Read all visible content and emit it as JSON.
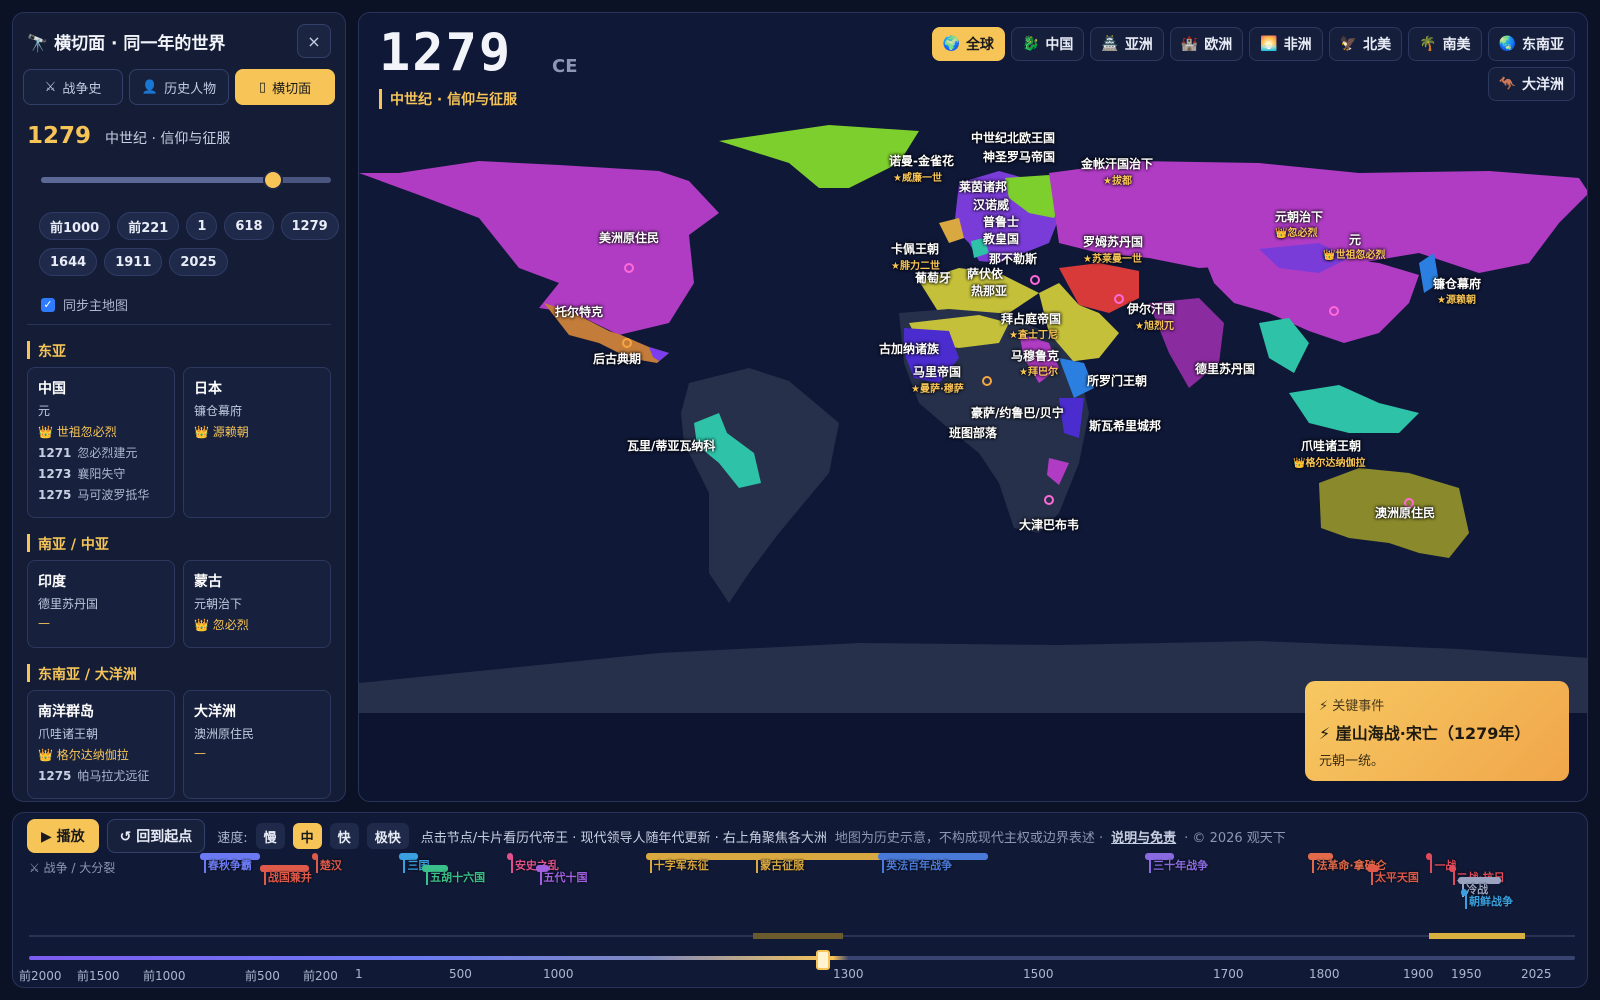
{
  "sidebar": {
    "title": "🔭 横切面 · 同一年的世界",
    "close": "×",
    "tabs": [
      {
        "icon": "⚔",
        "label": "战争史"
      },
      {
        "icon": "👤",
        "label": "历史人物"
      },
      {
        "icon": "▯",
        "label": "横切面"
      }
    ],
    "year": "1279",
    "era": "中世纪 · 信仰与征服",
    "slider_fraction": 0.8,
    "chips": [
      "前1000",
      "前221",
      "1",
      "618",
      "1279",
      "1644",
      "1911",
      "2025"
    ],
    "sync_label": "同步主地图",
    "sync_check": "✓",
    "regions": [
      {
        "name": "东亚",
        "cards": [
          {
            "title": "中国",
            "line": "元",
            "ruler": "👑 世祖忽必烈",
            "events": [
              [
                "1271",
                "忽必烈建元"
              ],
              [
                "1273",
                "襄阳失守"
              ],
              [
                "1275",
                "马可波罗抵华"
              ]
            ]
          },
          {
            "title": "日本",
            "line": "镰仓幕府",
            "ruler": "👑 源赖朝",
            "events": []
          }
        ]
      },
      {
        "name": "南亚 / 中亚",
        "cards": [
          {
            "title": "印度",
            "line": "德里苏丹国",
            "ruler": "—",
            "events": []
          },
          {
            "title": "蒙古",
            "line": "元朝治下",
            "ruler": "👑 忽必烈",
            "events": []
          }
        ]
      },
      {
        "name": "东南亚 / 大洋洲",
        "cards": [
          {
            "title": "南洋群岛",
            "line": "爪哇诸王朝",
            "ruler": "👑 格尔达纳伽拉",
            "events": [
              [
                "1275",
                "帕马拉尤远征"
              ]
            ]
          },
          {
            "title": "大洋洲",
            "line": "澳洲原住民",
            "ruler": "—",
            "events": []
          }
        ]
      }
    ]
  },
  "map": {
    "year": "1279",
    "ce": "CE",
    "era": "中世纪 · 信仰与征服",
    "region_buttons": [
      {
        "icon": "🌍",
        "label": "全球"
      },
      {
        "icon": "🐉",
        "label": "中国"
      },
      {
        "icon": "🏯",
        "label": "亚洲"
      },
      {
        "icon": "🏰",
        "label": "欧洲"
      },
      {
        "icon": "🌅",
        "label": "非洲"
      },
      {
        "icon": "🦅",
        "label": "北美"
      },
      {
        "icon": "🌴",
        "label": "南美"
      },
      {
        "icon": "🌏",
        "label": "东南亚"
      },
      {
        "icon": "🦘",
        "label": "大洋洲"
      }
    ],
    "labels": [
      {
        "t": "中世纪北欧王国",
        "k": "l"
      },
      {
        "t": "神圣罗马帝国",
        "k": "l"
      },
      {
        "t": "诺曼-金雀花",
        "k": "l"
      },
      {
        "t": "★威廉一世",
        "k": "r"
      },
      {
        "t": "金帐汗国治下",
        "k": "l"
      },
      {
        "t": "★拔都",
        "k": "r"
      },
      {
        "t": "莱茵诸邦",
        "k": "l"
      },
      {
        "t": "汉诺威",
        "k": "l"
      },
      {
        "t": "普鲁士",
        "k": "l"
      },
      {
        "t": "教皇国",
        "k": "l"
      },
      {
        "t": "那不勒斯",
        "k": "l"
      },
      {
        "t": "萨伏依",
        "k": "l"
      },
      {
        "t": "热那亚",
        "k": "l"
      },
      {
        "t": "葡萄牙",
        "k": "l"
      },
      {
        "t": "卡佩王朝",
        "k": "l"
      },
      {
        "t": "★腓力二世",
        "k": "r"
      },
      {
        "t": "美洲原住民",
        "k": "l"
      },
      {
        "t": "罗姆苏丹国",
        "k": "l"
      },
      {
        "t": "★苏莱曼一世",
        "k": "r"
      },
      {
        "t": "元朝治下",
        "k": "l"
      },
      {
        "t": "👑忽必烈",
        "k": "r"
      },
      {
        "t": "元",
        "k": "l"
      },
      {
        "t": "👑世祖忽必烈",
        "k": "r"
      },
      {
        "t": "镰仓幕府",
        "k": "l"
      },
      {
        "t": "★源赖朝",
        "k": "r"
      },
      {
        "t": "托尔特克",
        "k": "l"
      },
      {
        "t": "拜占庭帝国",
        "k": "l"
      },
      {
        "t": "★査士丁尼",
        "k": "r"
      },
      {
        "t": "伊尔汗国",
        "k": "l"
      },
      {
        "t": "★旭烈兀",
        "k": "r"
      },
      {
        "t": "古加纳诸族",
        "k": "l"
      },
      {
        "t": "马穆鲁克",
        "k": "l"
      },
      {
        "t": "★拜巴尔",
        "k": "r"
      },
      {
        "t": "后古典期",
        "k": "l"
      },
      {
        "t": "马里帝国",
        "k": "l"
      },
      {
        "t": "★曼萨·穆萨",
        "k": "r"
      },
      {
        "t": "所罗门王朝",
        "k": "l"
      },
      {
        "t": "德里苏丹国",
        "k": "l"
      },
      {
        "t": "豪萨/约鲁巴/贝宁",
        "k": "l"
      },
      {
        "t": "斯瓦希里城邦",
        "k": "l"
      },
      {
        "t": "班图部落",
        "k": "l"
      },
      {
        "t": "瓦里/蒂亚瓦纳科",
        "k": "l"
      },
      {
        "t": "爪哇诸王朝",
        "k": "l"
      },
      {
        "t": "👑格尔达纳伽拉",
        "k": "r"
      },
      {
        "t": "大津巴布韦",
        "k": "l"
      },
      {
        "t": "澳洲原住民",
        "k": "l"
      }
    ],
    "key_event": {
      "heading": "⚡ 关键事件",
      "title": "⚡ 崖山海战·宋亡（1279年）",
      "desc": "元朝一统。"
    }
  },
  "controls": {
    "play": "▶ 播放",
    "reset": "↺ 回到起点",
    "speed_label": "速度:",
    "speeds": [
      "慢",
      "中",
      "快",
      "极快"
    ],
    "hint": "点击节点/卡片看历代帝王 · 现代领导人随年代更新 · 右上角聚焦各大洲",
    "disclaimer": "地图为历史示意，不构成现代主权或边界表述 ·",
    "link": "说明与免责",
    "copyright": "· © 2026 观天下"
  },
  "timeline": {
    "wars_label": "⚔ 战争 / 大分裂",
    "min": -2000,
    "max": 2025,
    "current": 1279,
    "events": [
      {
        "label": "春秋争霸",
        "start": -770,
        "end": -476,
        "row": 0,
        "color": "#6b7af2"
      },
      {
        "label": "战国兼并",
        "start": -475,
        "end": -221,
        "row": 1,
        "color": "#e05a4a"
      },
      {
        "label": "楚汉",
        "start": -206,
        "end": -202,
        "row": 0,
        "color": "#e05a4a"
      },
      {
        "label": "三国",
        "start": 184,
        "end": 280,
        "row": 0,
        "color": "#3aa0e0"
      },
      {
        "label": "五胡十六国",
        "start": 304,
        "end": 439,
        "row": 1,
        "color": "#3ac08a"
      },
      {
        "label": "安史之乱",
        "start": 755,
        "end": 763,
        "row": 0,
        "color": "#e0508a"
      },
      {
        "label": "五代十国",
        "start": 907,
        "end": 979,
        "row": 1,
        "color": "#a060e0"
      },
      {
        "label": "十字军东征",
        "start": 1096,
        "end": 1291,
        "row": 0,
        "color": "#d9a840"
      },
      {
        "label": "蒙古征服",
        "start": 1206,
        "end": 1368,
        "row": 0,
        "color": "#d9a840"
      },
      {
        "label": "英法百年战争",
        "start": 1337,
        "end": 1453,
        "row": 0,
        "color": "#4a7ad8"
      },
      {
        "label": "三十年战争",
        "start": 1618,
        "end": 1648,
        "row": 0,
        "color": "#8a6ae0"
      },
      {
        "label": "法革命·拿破仑",
        "start": 1789,
        "end": 1815,
        "row": 0,
        "color": "#e06a4a"
      },
      {
        "label": "太平天国",
        "start": 1851,
        "end": 1864,
        "row": 1,
        "color": "#e05a4a"
      },
      {
        "label": "一战",
        "start": 1914,
        "end": 1918,
        "row": 0,
        "color": "#e04a5a"
      },
      {
        "label": "二战·抗日",
        "start": 1937,
        "end": 1945,
        "row": 1,
        "color": "#e04a5a"
      },
      {
        "label": "冷战",
        "start": 1947,
        "end": 1991,
        "row": 2,
        "color": "#9aa4c0"
      },
      {
        "label": "朝鲜战争",
        "start": 1950,
        "end": 1953,
        "row": 3,
        "color": "#3aa0e0"
      }
    ],
    "ticks": [
      {
        "label": "前2000",
        "v": -2000
      },
      {
        "label": "前1500",
        "v": -1500
      },
      {
        "label": "前1000",
        "v": -1000
      },
      {
        "label": "前500",
        "v": -500
      },
      {
        "label": "前200",
        "v": -200
      },
      {
        "label": "1",
        "v": 1
      },
      {
        "label": "500",
        "v": 500
      },
      {
        "label": "1000",
        "v": 1000
      },
      {
        "label": "1300",
        "v": 1300
      },
      {
        "label": "1500",
        "v": 1500
      },
      {
        "label": "1700",
        "v": 1700
      },
      {
        "label": "1800",
        "v": 1800
      },
      {
        "label": "1900",
        "v": 1900
      },
      {
        "label": "1950",
        "v": 1950
      },
      {
        "label": "2025",
        "v": 2025
      }
    ]
  }
}
